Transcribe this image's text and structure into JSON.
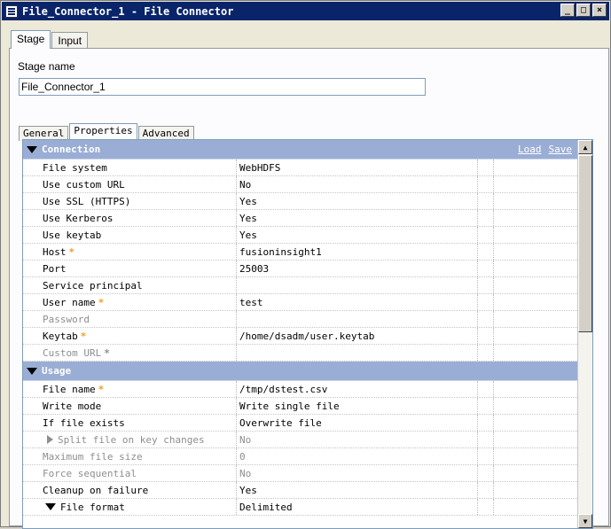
{
  "window": {
    "title": "File_Connector_1 - File Connector",
    "buttons": {
      "minimize": "_",
      "maximize": "□",
      "close": "×"
    }
  },
  "top_tabs": [
    {
      "label": "Stage",
      "active": true
    },
    {
      "label": "Input",
      "active": false
    }
  ],
  "stage": {
    "name_label": "Stage name",
    "name_value": "File_Connector_1"
  },
  "inner_tabs": [
    {
      "label": "General",
      "active": false
    },
    {
      "label": "Properties",
      "active": true
    },
    {
      "label": "Advanced",
      "active": false
    }
  ],
  "properties": {
    "load_link": "Load",
    "save_link": "Save",
    "connection": {
      "title": "Connection",
      "rows": [
        {
          "name": "File system",
          "value": "WebHDFS",
          "required": false,
          "disabled": false
        },
        {
          "name": "Use custom URL",
          "value": "No",
          "required": false,
          "disabled": false
        },
        {
          "name": "Use SSL (HTTPS)",
          "value": "Yes",
          "required": false,
          "disabled": false
        },
        {
          "name": "Use Kerberos",
          "value": "Yes",
          "required": false,
          "disabled": false
        },
        {
          "name": "Use keytab",
          "value": "Yes",
          "required": false,
          "disabled": false
        },
        {
          "name": "Host",
          "value": "fusioninsight1",
          "required": true,
          "disabled": false
        },
        {
          "name": "Port",
          "value": "25003",
          "required": false,
          "disabled": false
        },
        {
          "name": "Service principal",
          "value": "",
          "required": false,
          "disabled": false
        },
        {
          "name": "User name",
          "value": "test",
          "required": true,
          "disabled": false
        },
        {
          "name": "Password",
          "value": "",
          "required": false,
          "disabled": true
        },
        {
          "name": "Keytab",
          "value": "/home/dsadm/user.keytab",
          "required": true,
          "disabled": false
        },
        {
          "name": "Custom URL",
          "value": "",
          "required": true,
          "disabled": true
        }
      ]
    },
    "usage": {
      "title": "Usage",
      "rows": [
        {
          "name": "File name",
          "value": "/tmp/dstest.csv",
          "required": true,
          "disabled": false
        },
        {
          "name": "Write mode",
          "value": "Write single file",
          "required": false,
          "disabled": false
        },
        {
          "name": "If file exists",
          "value": "Overwrite file",
          "required": false,
          "disabled": false
        },
        {
          "name": "Split file on key changes",
          "value": "No",
          "required": false,
          "disabled": true
        },
        {
          "name": "Maximum file size",
          "value": "0",
          "required": false,
          "disabled": true
        },
        {
          "name": "Force sequential",
          "value": "No",
          "required": false,
          "disabled": true
        },
        {
          "name": "Cleanup on failure",
          "value": "Yes",
          "required": false,
          "disabled": false
        },
        {
          "name": "File format",
          "value": "Delimited",
          "required": false,
          "disabled": false
        }
      ]
    }
  },
  "colors": {
    "section_header": "#9aadd5",
    "required_star": "#f29e1f",
    "titlebar": "#0a246a"
  },
  "icons": [
    "window-app-icon",
    "collapse-triangle-icon",
    "expand-triangle-icon",
    "scroll-up-icon",
    "scroll-down-icon"
  ]
}
